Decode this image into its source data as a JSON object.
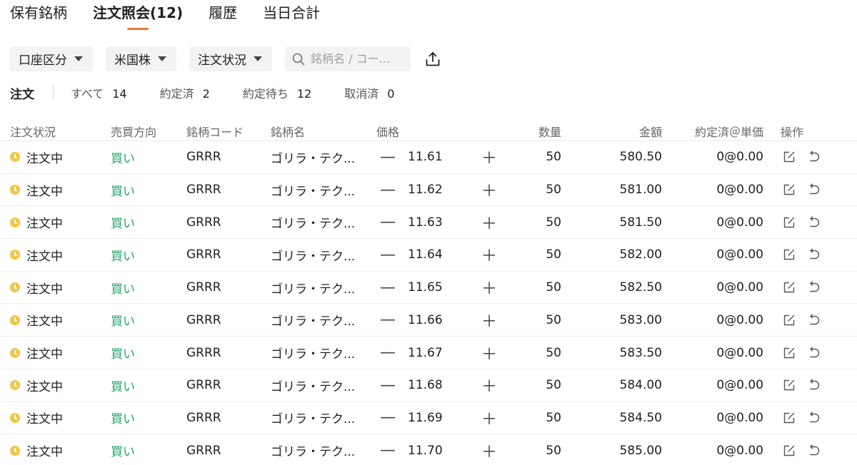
{
  "tabs": [
    {
      "label": "保有銘柄",
      "active": false
    },
    {
      "label": "注文照会(12)",
      "active": true
    },
    {
      "label": "履歴",
      "active": false
    },
    {
      "label": "当日合計",
      "active": false
    }
  ],
  "filters": {
    "account": "口座区分",
    "market": "米国株",
    "order_status": "注文状況",
    "search_placeholder": "銘柄名 / コー..."
  },
  "counts": {
    "label": "注文",
    "items": [
      {
        "label": "すべて",
        "value": "14"
      },
      {
        "label": "約定済",
        "value": "2"
      },
      {
        "label": "約定待ち",
        "value": "12"
      },
      {
        "label": "取消済",
        "value": "0"
      }
    ]
  },
  "columns": {
    "status": "注文状況",
    "side": "売買方向",
    "code": "銘柄コード",
    "name": "銘柄名",
    "price": "価格",
    "qty": "数量",
    "amount": "金額",
    "filled": "約定済＠単価",
    "ops": "操作"
  },
  "stepper": {
    "minus": "—",
    "plus": "＋"
  },
  "rows": [
    {
      "status": "注文中",
      "side": "買い",
      "code": "GRRR",
      "name": "ゴリラ・テク...",
      "price": "11.61",
      "qty": "50",
      "amount": "580.50",
      "filled": "0@0.00"
    },
    {
      "status": "注文中",
      "side": "買い",
      "code": "GRRR",
      "name": "ゴリラ・テク...",
      "price": "11.62",
      "qty": "50",
      "amount": "581.00",
      "filled": "0@0.00"
    },
    {
      "status": "注文中",
      "side": "買い",
      "code": "GRRR",
      "name": "ゴリラ・テク...",
      "price": "11.63",
      "qty": "50",
      "amount": "581.50",
      "filled": "0@0.00"
    },
    {
      "status": "注文中",
      "side": "買い",
      "code": "GRRR",
      "name": "ゴリラ・テク...",
      "price": "11.64",
      "qty": "50",
      "amount": "582.00",
      "filled": "0@0.00"
    },
    {
      "status": "注文中",
      "side": "買い",
      "code": "GRRR",
      "name": "ゴリラ・テク...",
      "price": "11.65",
      "qty": "50",
      "amount": "582.50",
      "filled": "0@0.00"
    },
    {
      "status": "注文中",
      "side": "買い",
      "code": "GRRR",
      "name": "ゴリラ・テク...",
      "price": "11.66",
      "qty": "50",
      "amount": "583.00",
      "filled": "0@0.00"
    },
    {
      "status": "注文中",
      "side": "買い",
      "code": "GRRR",
      "name": "ゴリラ・テク...",
      "price": "11.67",
      "qty": "50",
      "amount": "583.50",
      "filled": "0@0.00"
    },
    {
      "status": "注文中",
      "side": "買い",
      "code": "GRRR",
      "name": "ゴリラ・テク...",
      "price": "11.68",
      "qty": "50",
      "amount": "584.00",
      "filled": "0@0.00"
    },
    {
      "status": "注文中",
      "side": "買い",
      "code": "GRRR",
      "name": "ゴリラ・テク...",
      "price": "11.69",
      "qty": "50",
      "amount": "584.50",
      "filled": "0@0.00"
    },
    {
      "status": "注文中",
      "side": "買い",
      "code": "GRRR",
      "name": "ゴリラ・テク...",
      "price": "11.70",
      "qty": "50",
      "amount": "585.00",
      "filled": "0@0.00"
    }
  ],
  "colors": {
    "accent": "#f0783c",
    "buy": "#22a36a",
    "pending": "#f4c542"
  },
  "icons": {
    "search": "search-icon",
    "export": "export-icon",
    "edit": "edit-icon",
    "cancel": "undo-icon",
    "status": "clock-icon"
  }
}
